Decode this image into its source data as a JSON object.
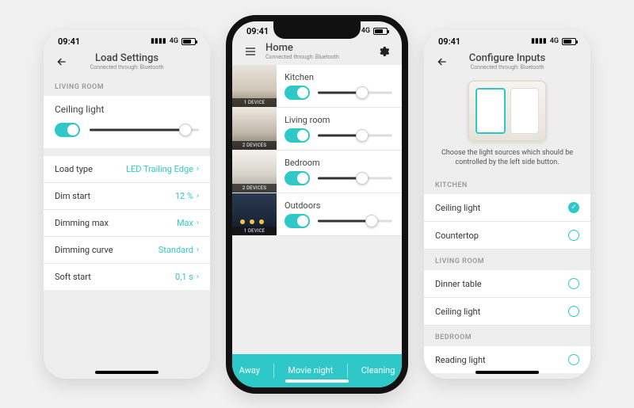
{
  "status": {
    "time": "09:41",
    "net": "4G"
  },
  "left": {
    "title": "Load Settings",
    "subtitle": "Connected through: Bluetooth",
    "section": "LIVING ROOM",
    "device_name": "Ceiling light",
    "slider_pct": 88,
    "settings": [
      {
        "label": "Load type",
        "value": "LED Trailing Edge"
      },
      {
        "label": "Dim start",
        "value": "12 %"
      },
      {
        "label": "Dimming max",
        "value": "Max"
      },
      {
        "label": "Dimming curve",
        "value": "Standard"
      },
      {
        "label": "Soft start",
        "value": "0,1 s"
      }
    ]
  },
  "center": {
    "title": "Home",
    "subtitle": "Connected through: Bluetooth",
    "rooms": [
      {
        "name": "Kitchen",
        "badge": "1 DEVICE",
        "slider_pct": 60,
        "img": "kitchen"
      },
      {
        "name": "Living room",
        "badge": "2 DEVICES",
        "slider_pct": 60,
        "img": "living"
      },
      {
        "name": "Bedroom",
        "badge": "2 DEVICES",
        "slider_pct": 60,
        "img": "bedroom"
      },
      {
        "name": "Outdoors",
        "badge": "1 DEVICE",
        "slider_pct": 72,
        "img": "outdoor"
      }
    ],
    "scenes": [
      "Away",
      "Movie night",
      "Cleaning"
    ]
  },
  "right": {
    "title": "Configure Inputs",
    "subtitle": "Connected through: Bluetooth",
    "instruction": "Choose the light sources which should be controlled by the left side button.",
    "sections": [
      {
        "heading": "KITCHEN",
        "items": [
          {
            "label": "Ceiling light",
            "checked": true
          },
          {
            "label": "Countertop",
            "checked": false
          }
        ]
      },
      {
        "heading": "LIVING ROOM",
        "items": [
          {
            "label": "Dinner table",
            "checked": false
          },
          {
            "label": "Ceiling light",
            "checked": false
          }
        ]
      },
      {
        "heading": "BEDROOM",
        "items": [
          {
            "label": "Reading light",
            "checked": false
          }
        ]
      }
    ]
  }
}
